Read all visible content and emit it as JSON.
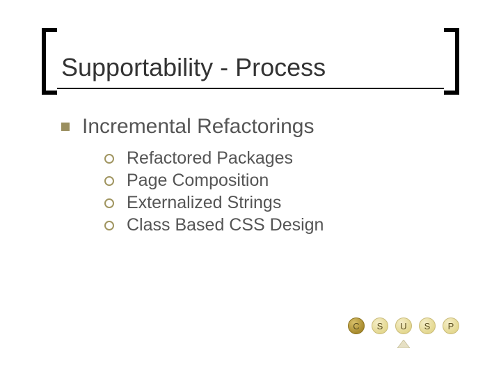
{
  "slide": {
    "title": "Supportability - Process",
    "bullets": {
      "heading": "Incremental Refactorings",
      "items": [
        "Refactored Packages",
        "Page Composition",
        "Externalized Strings",
        "Class Based CSS Design"
      ]
    },
    "badges": [
      {
        "letter": "C",
        "style": "dark"
      },
      {
        "letter": "S",
        "style": "light"
      },
      {
        "letter": "U",
        "style": "light"
      },
      {
        "letter": "S",
        "style": "light"
      },
      {
        "letter": "P",
        "style": "light"
      }
    ],
    "pointer_under_index": 2
  }
}
